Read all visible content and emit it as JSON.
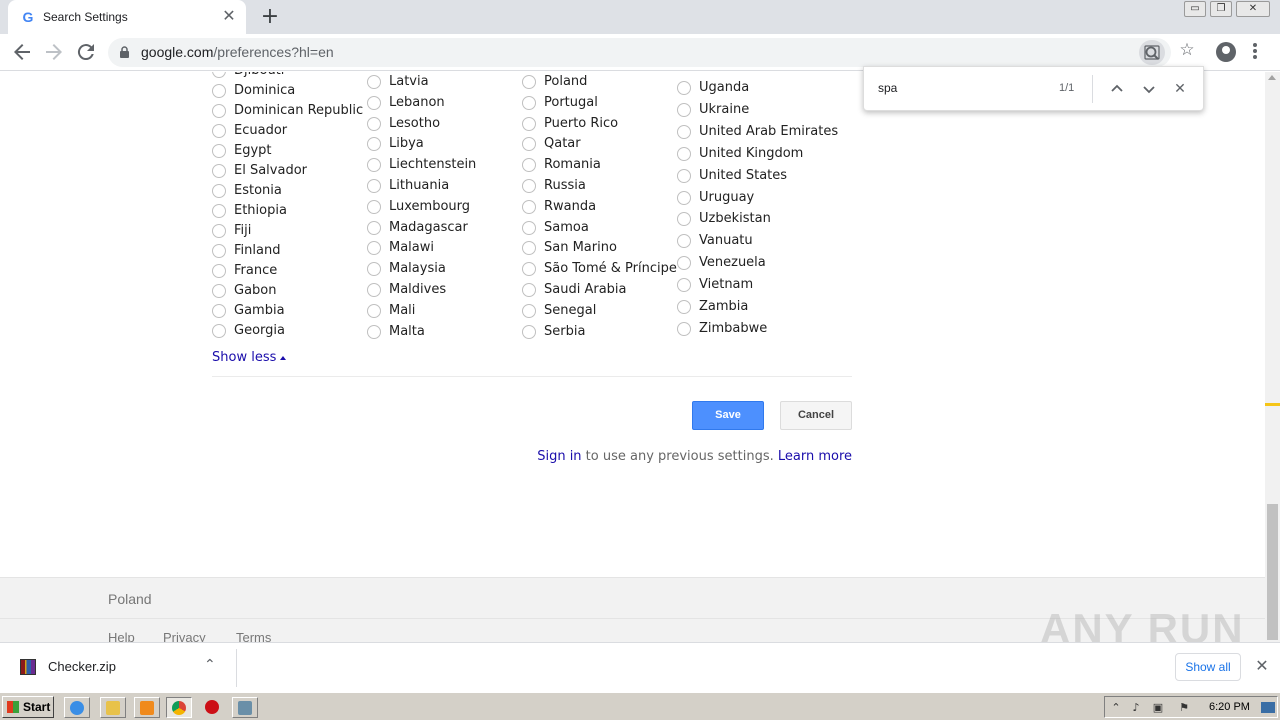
{
  "browser": {
    "tab": {
      "favicon": "G",
      "title": "Search Settings",
      "close": "✕"
    },
    "new_tab": "+",
    "window_controls": {
      "minimize": "▭",
      "restore": "❐",
      "close": "✕"
    },
    "url": {
      "host": "google.com",
      "path": "/preferences?hl=en"
    },
    "icons": [
      "back-icon",
      "forward-icon",
      "reload-icon",
      "lock-icon",
      "zoom-icon",
      "star-icon",
      "profile-icon",
      "menu-icon"
    ]
  },
  "find_bar": {
    "query": "spa",
    "count": "1/1",
    "prev": "⌃",
    "next": "⌄",
    "close": "✕"
  },
  "regions": {
    "col1": [
      "Djibouti",
      "Dominica",
      "Dominican Republic",
      "Ecuador",
      "Egypt",
      "El Salvador",
      "Estonia",
      "Ethiopia",
      "Fiji",
      "Finland",
      "France",
      "Gabon",
      "Gambia",
      "Georgia"
    ],
    "col2": [
      "Latvia",
      "Lebanon",
      "Lesotho",
      "Libya",
      "Liechtenstein",
      "Lithuania",
      "Luxembourg",
      "Madagascar",
      "Malawi",
      "Malaysia",
      "Maldives",
      "Mali",
      "Malta"
    ],
    "col3": [
      "Poland",
      "Portugal",
      "Puerto Rico",
      "Qatar",
      "Romania",
      "Russia",
      "Rwanda",
      "Samoa",
      "San Marino",
      "São Tomé & Príncipe",
      "Saudi Arabia",
      "Senegal",
      "Serbia"
    ],
    "col4": [
      "Uganda",
      "Ukraine",
      "United Arab Emirates",
      "United Kingdom",
      "United States",
      "Uruguay",
      "Uzbekistan",
      "Vanuatu",
      "Venezuela",
      "Vietnam",
      "Zambia",
      "Zimbabwe"
    ]
  },
  "show_less": "Show less",
  "buttons": {
    "save": "Save",
    "cancel": "Cancel"
  },
  "signin": {
    "link": "Sign in",
    "text": " to use any previous settings. ",
    "learn_more": "Learn more"
  },
  "footer": {
    "country": "Poland",
    "links": [
      "Help",
      "Privacy",
      "Terms"
    ]
  },
  "download_shelf": {
    "filename": "Checker.zip",
    "chevron": "⌃",
    "show_all": "Show all",
    "close": "✕"
  },
  "watermark": "ANY RUN",
  "taskbar": {
    "start": "Start",
    "clock": "6:20 PM"
  },
  "colors": {
    "link": "#1a0dab",
    "save_button": "#4d90fe",
    "find_marker": "#f5c518"
  }
}
